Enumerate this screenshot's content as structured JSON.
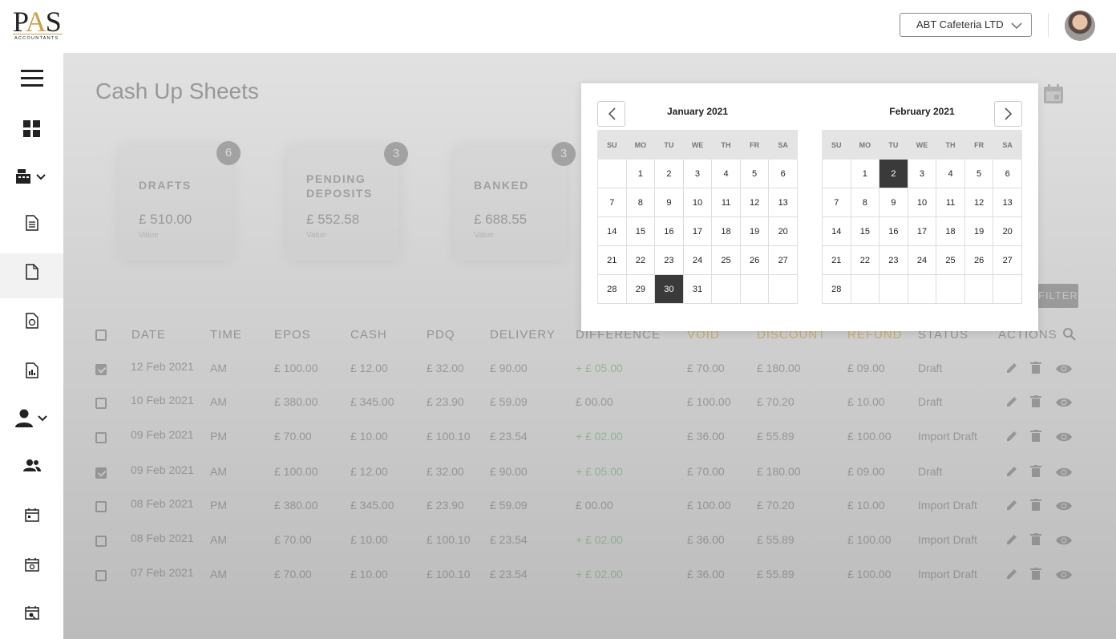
{
  "header": {
    "logo_main": "PAS",
    "logo_sub": "ACCOUNTANTS",
    "company_select": "ABT Cafeteria LTD"
  },
  "sidebar": {
    "items": [
      "menu-icon",
      "dashboard-icon",
      "cash-register-icon",
      "document-icon",
      "file-icon",
      "file-money-icon",
      "file-report-icon",
      "user-icon",
      "users-icon",
      "calendar-icon",
      "calendar-money-icon",
      "calendar-report-icon"
    ]
  },
  "page": {
    "title": "Cash Up Sheets",
    "filter_label": "FILTER"
  },
  "cards": [
    {
      "label": "DRAFTS",
      "value": "£ 510.00",
      "sub": "Value",
      "badge": "6"
    },
    {
      "label": "PENDING\nDEPOSITS",
      "value": "£ 552.58",
      "sub": "Value",
      "badge": "3"
    },
    {
      "label": "BANKED",
      "value": "£ 688.55",
      "sub": "Value",
      "badge": "3"
    }
  ],
  "table": {
    "headers": [
      "DATE",
      "TIME",
      "EPOS",
      "CASH",
      "PDQ",
      "DELIVERY",
      "DIFFERENCE",
      "VOID",
      "DISCOUNT",
      "REFUND",
      "STATUS",
      "ACTIONS"
    ],
    "rows": [
      {
        "checked": true,
        "date": "12 Feb 2021",
        "time": "AM",
        "epos": "£ 100.00",
        "cash": "£ 12.00",
        "pdq": "£ 32.00",
        "delivery": "£ 90.00",
        "difference": "+ £ 05.00",
        "diff_positive": true,
        "void": "£ 70.00",
        "discount": "£ 180.00",
        "refund": "£ 09.00",
        "status": "Draft"
      },
      {
        "checked": false,
        "date": "10 Feb 2021",
        "time": "AM",
        "epos": "£ 380.00",
        "cash": "£ 345.00",
        "pdq": "£ 23.90",
        "delivery": "£ 59.09",
        "difference": "£ 00.00",
        "diff_positive": false,
        "void": "£ 100.00",
        "discount": "£ 70.20",
        "refund": "£ 10.00",
        "status": "Draft"
      },
      {
        "checked": false,
        "date": "09 Feb 2021",
        "time": "PM",
        "epos": "£ 70.00",
        "cash": "£ 10.00",
        "pdq": "£ 100.10",
        "delivery": "£ 23.54",
        "difference": "+ £ 02.00",
        "diff_positive": true,
        "void": "£ 36.00",
        "discount": "£ 55.89",
        "refund": "£ 100.00",
        "status": "Import Draft"
      },
      {
        "checked": true,
        "date": "09 Feb 2021",
        "time": "AM",
        "epos": "£ 100.00",
        "cash": "£ 12.00",
        "pdq": "£ 32.00",
        "delivery": "£ 90.00",
        "difference": "+ £ 05.00",
        "diff_positive": true,
        "void": "£ 70.00",
        "discount": "£ 180.00",
        "refund": "£ 09.00",
        "status": "Draft"
      },
      {
        "checked": false,
        "date": "08 Feb 2021",
        "time": "PM",
        "epos": "£ 380.00",
        "cash": "£ 345.00",
        "pdq": "£ 23.90",
        "delivery": "£ 59.09",
        "difference": "£ 00.00",
        "diff_positive": false,
        "void": "£ 100.00",
        "discount": "£ 70.20",
        "refund": "£ 10.00",
        "status": "Import Draft"
      },
      {
        "checked": false,
        "date": "08 Feb 2021",
        "time": "AM",
        "epos": "£ 70.00",
        "cash": "£ 10.00",
        "pdq": "£ 100.10",
        "delivery": "£ 23.54",
        "difference": "+ £ 02.00",
        "diff_positive": true,
        "void": "£ 36.00",
        "discount": "£ 55.89",
        "refund": "£ 100.00",
        "status": "Import Draft"
      },
      {
        "checked": false,
        "date": "07 Feb 2021",
        "time": "AM",
        "epos": "£ 70.00",
        "cash": "£ 10.00",
        "pdq": "£ 100.10",
        "delivery": "£ 23.54",
        "difference": "+ £ 02.00",
        "diff_positive": true,
        "void": "£ 36.00",
        "discount": "£ 55.89",
        "refund": "£ 100.00",
        "status": "Import Draft"
      }
    ]
  },
  "datepicker": {
    "weekdays": [
      "SU",
      "MO",
      "TU",
      "WE",
      "TH",
      "FR",
      "SA"
    ],
    "months": [
      {
        "title": "January 2021",
        "start_weekday": 1,
        "days": 31,
        "selected": 30
      },
      {
        "title": "February 2021",
        "start_weekday": 1,
        "days": 28,
        "selected": 2
      }
    ]
  },
  "colors": {
    "positive": "#9fcf9f",
    "void_header": "#e6c46a",
    "selected_day": "#3a3a3a"
  }
}
